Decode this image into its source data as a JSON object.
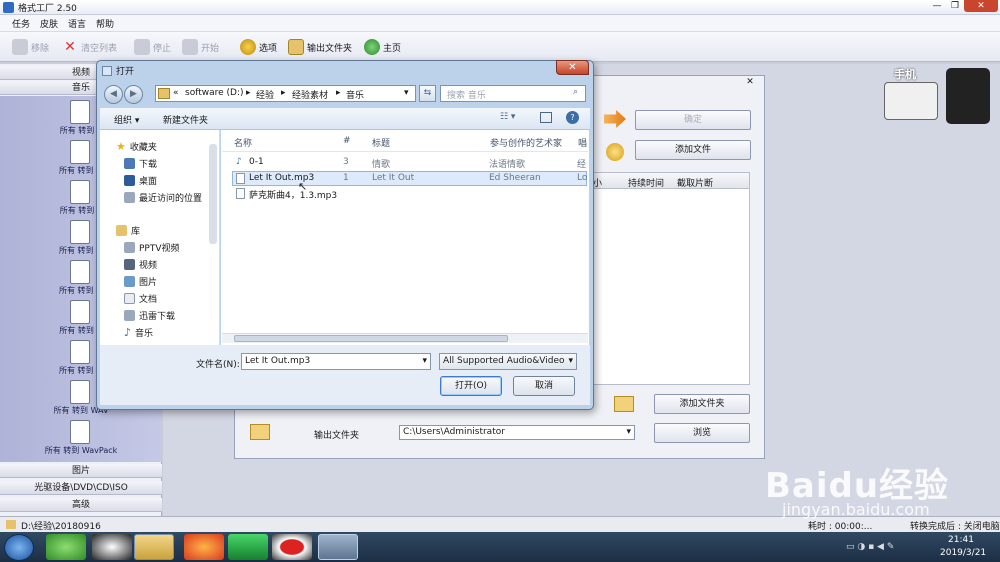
{
  "app": {
    "title": "格式工厂 2.50"
  },
  "menu": [
    "任务",
    "皮肤",
    "语言",
    "帮助"
  ],
  "toolbar": {
    "remove": "移除",
    "clear": "清空列表",
    "stop": "停止",
    "start": "开始",
    "options": "选项",
    "output_folder": "输出文件夹",
    "home": "主页"
  },
  "sidebar": {
    "video": "视频",
    "audio": "音乐",
    "formats": [
      {
        "icon": "aac-file-icon",
        "label": "所有 转到 A"
      },
      {
        "icon": "mp2-file-icon",
        "label": "所有 转到 M"
      },
      {
        "icon": "amr-file-icon",
        "label": "所有 转到 A"
      },
      {
        "icon": "mmf-file-icon",
        "label": "所有 转到 M"
      },
      {
        "icon": "m4a-file-icon",
        "label": "所有 转到 M"
      },
      {
        "icon": "ogg-file-icon",
        "label": "所有 转到 O"
      },
      {
        "icon": "mp3-file-icon",
        "label": "所有 转到 M"
      },
      {
        "icon": "wav-file-icon",
        "label": "所有 转到 WAV"
      },
      {
        "icon": "wavpack-file-icon",
        "label": "所有 转到 WavPack"
      }
    ],
    "picture": "图片",
    "optical": "光驱设备\\DVD\\CD\\ISO",
    "advanced": "高级"
  },
  "panel": {
    "ok_button": "确定",
    "add_file_button": "添加文件",
    "table_headers": [
      "小",
      "持续时间",
      "截取片断"
    ],
    "add_folder_button": "添加文件夹",
    "output_label": "输出文件夹",
    "output_path": "C:\\Users\\Administrator",
    "browse_button": "浏览"
  },
  "phone_label": "手机",
  "status": {
    "path": "D:\\经验\\20180916",
    "time_partial": "耗时 : 00:00:...",
    "after_convert": "转换完成后 : 关闭电脑"
  },
  "taskbar": {
    "time": "21:41",
    "date": "2019/3/21"
  },
  "dialog": {
    "title": "打开",
    "address": [
      "«",
      "software (D:)",
      "经验",
      "经验素材",
      "音乐"
    ],
    "search_placeholder": "搜索 音乐",
    "organize": "组织",
    "new_folder": "新建文件夹",
    "nav": {
      "favorites": "收藏夹",
      "favorites_items": [
        "下载",
        "桌面",
        "最近访问的位置"
      ],
      "libraries": "库",
      "library_items": [
        "PPTV视频",
        "视频",
        "图片",
        "文档",
        "迅雷下载",
        "音乐"
      ]
    },
    "columns": [
      "名称",
      "#",
      "标题",
      "参与创作的艺术家",
      "唱"
    ],
    "files": [
      {
        "name": "0-1",
        "num": "3",
        "title": "情歌",
        "artist": "法语情歌",
        "album": "经"
      },
      {
        "name": "Let It Out.mp3",
        "num": "1",
        "title": "Let It Out",
        "artist": "Ed Sheeran",
        "album": "Lo"
      },
      {
        "name": "萨克斯曲4，1.3.mp3",
        "num": "",
        "title": "",
        "artist": "",
        "album": ""
      }
    ],
    "filename_label": "文件名(N):",
    "filename_value": "Let It Out.mp3",
    "filter": "All Supported Audio&Video",
    "open_button": "打开(O)",
    "cancel_button": "取消"
  },
  "watermark": {
    "brand": "Baidu经验",
    "url": "jingyan.baidu.com"
  },
  "colors": {
    "accent": "#3a6ea5",
    "sidebar_format_bg": "#aeb3d7",
    "selected_row": "#dceafb"
  }
}
